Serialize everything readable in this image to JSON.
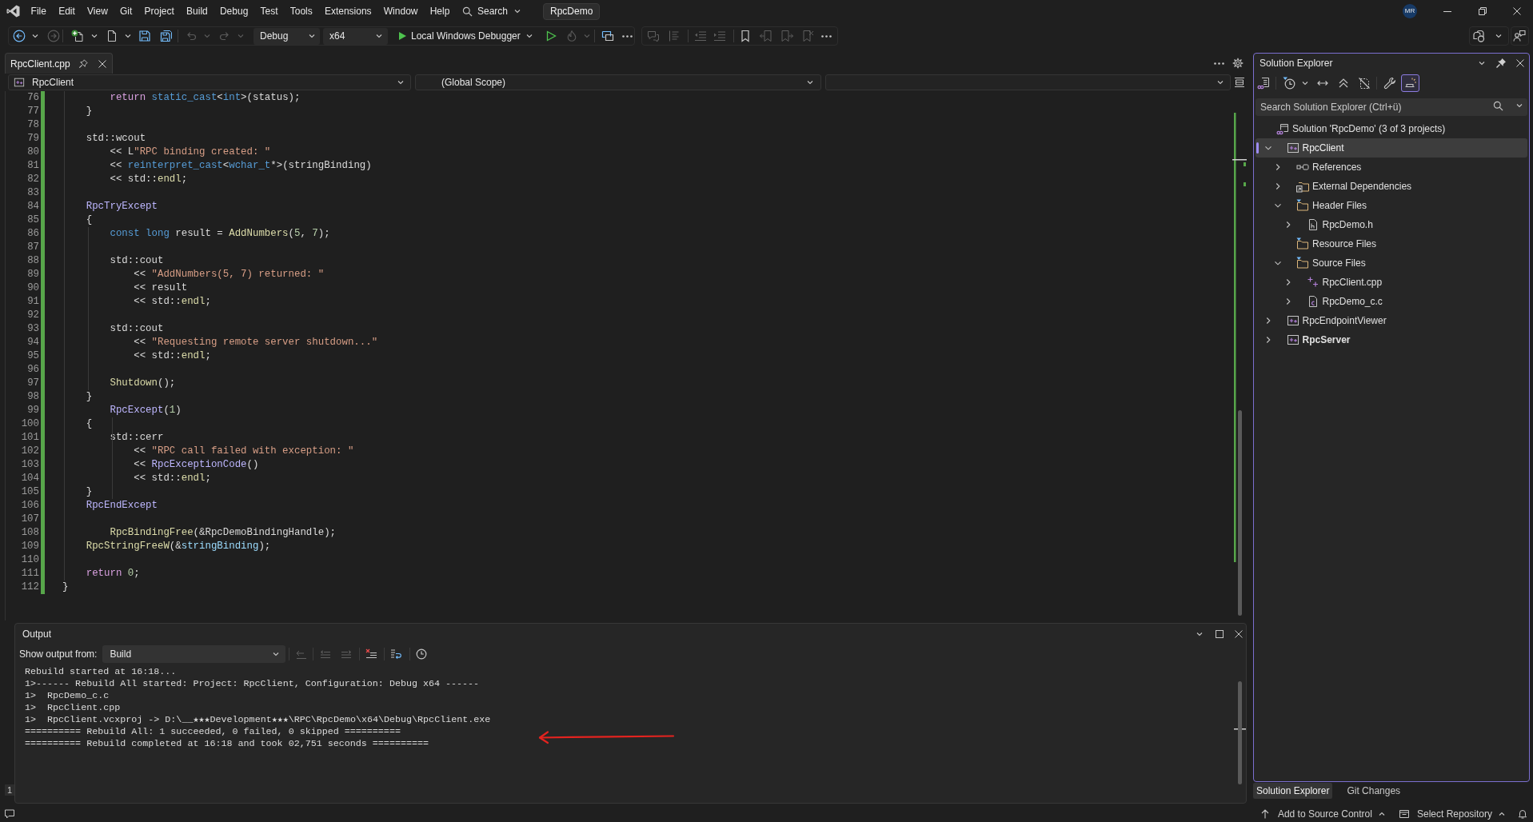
{
  "title_bar": {
    "menu": [
      "File",
      "Edit",
      "View",
      "Git",
      "Project",
      "Build",
      "Debug",
      "Test",
      "Tools",
      "Extensions",
      "Window",
      "Help"
    ],
    "search": "Search",
    "solution_name": "RpcDemo",
    "account_initials": "MR"
  },
  "toolbar": {
    "configuration": "Debug",
    "platform": "x64",
    "start_debugging": "Local Windows Debugger"
  },
  "editor": {
    "tabs": [
      {
        "label": "RpcClient.cpp",
        "selected": true
      }
    ],
    "navigation": {
      "project": "RpcClient",
      "scope": "(Global Scope)"
    },
    "lines": [
      {
        "number": "76",
        "tokens": [
          {
            "text": "        return",
            "kind": "control"
          },
          {
            "text": " static_cast",
            "kind": "keyword"
          },
          {
            "text": "<",
            "kind": "plain"
          },
          {
            "text": "int",
            "kind": "keyword"
          },
          {
            "text": ">(status);",
            "kind": "plain"
          }
        ]
      },
      {
        "number": "77",
        "tokens": [
          {
            "text": "    }",
            "kind": "plain"
          }
        ]
      },
      {
        "number": "78"
      },
      {
        "number": "79",
        "tokens": [
          {
            "text": "    std::wcout",
            "kind": "plain"
          }
        ]
      },
      {
        "number": "80",
        "tokens": [
          {
            "text": "        << L",
            "kind": "plain"
          },
          {
            "text": "\"RPC binding created: \"",
            "kind": "string"
          }
        ]
      },
      {
        "number": "81",
        "tokens": [
          {
            "text": "        << ",
            "kind": "plain"
          },
          {
            "text": "reinterpret_cast",
            "kind": "keyword"
          },
          {
            "text": "<",
            "kind": "plain"
          },
          {
            "text": "wchar_t",
            "kind": "keyword"
          },
          {
            "text": "*>(stringBinding)",
            "kind": "plain"
          }
        ]
      },
      {
        "number": "82",
        "tokens": [
          {
            "text": "        << std::",
            "kind": "plain"
          },
          {
            "text": "endl",
            "kind": "function"
          },
          {
            "text": ";",
            "kind": "plain"
          }
        ]
      },
      {
        "number": "83"
      },
      {
        "number": "84",
        "tokens": [
          {
            "text": "    RpcTryExcept",
            "kind": "macro"
          }
        ]
      },
      {
        "number": "85",
        "tokens": [
          {
            "text": "    {",
            "kind": "plain"
          }
        ]
      },
      {
        "number": "86",
        "tokens": [
          {
            "text": "        const long",
            "kind": "keyword"
          },
          {
            "text": " result = ",
            "kind": "plain"
          },
          {
            "text": "AddNumbers",
            "kind": "function"
          },
          {
            "text": "(",
            "kind": "plain"
          },
          {
            "text": "5",
            "kind": "number"
          },
          {
            "text": ", ",
            "kind": "plain"
          },
          {
            "text": "7",
            "kind": "number"
          },
          {
            "text": ");",
            "kind": "plain"
          }
        ]
      },
      {
        "number": "87"
      },
      {
        "number": "88",
        "tokens": [
          {
            "text": "        std::cout",
            "kind": "plain"
          }
        ]
      },
      {
        "number": "89",
        "tokens": [
          {
            "text": "            << ",
            "kind": "plain"
          },
          {
            "text": "\"AddNumbers(5, 7) returned: \"",
            "kind": "string"
          }
        ]
      },
      {
        "number": "90",
        "tokens": [
          {
            "text": "            << result",
            "kind": "plain"
          }
        ]
      },
      {
        "number": "91",
        "tokens": [
          {
            "text": "            << std::",
            "kind": "plain"
          },
          {
            "text": "endl",
            "kind": "function"
          },
          {
            "text": ";",
            "kind": "plain"
          }
        ]
      },
      {
        "number": "92"
      },
      {
        "number": "93",
        "tokens": [
          {
            "text": "        std::cout",
            "kind": "plain"
          }
        ]
      },
      {
        "number": "94",
        "tokens": [
          {
            "text": "            << ",
            "kind": "plain"
          },
          {
            "text": "\"Requesting remote server shutdown...\"",
            "kind": "string"
          }
        ]
      },
      {
        "number": "95",
        "tokens": [
          {
            "text": "            << std::",
            "kind": "plain"
          },
          {
            "text": "endl",
            "kind": "function"
          },
          {
            "text": ";",
            "kind": "plain"
          }
        ]
      },
      {
        "number": "96"
      },
      {
        "number": "97",
        "tokens": [
          {
            "text": "        Shutdown",
            "kind": "function"
          },
          {
            "text": "();",
            "kind": "plain"
          }
        ]
      },
      {
        "number": "98",
        "tokens": [
          {
            "text": "    }",
            "kind": "plain"
          }
        ]
      },
      {
        "number": "99",
        "tokens": [
          {
            "text": "        RpcExcept",
            "kind": "macro"
          },
          {
            "text": "(",
            "kind": "plain"
          },
          {
            "text": "1",
            "kind": "number"
          },
          {
            "text": ")",
            "kind": "plain"
          }
        ]
      },
      {
        "number": "100",
        "tokens": [
          {
            "text": "    {",
            "kind": "plain"
          }
        ]
      },
      {
        "number": "101",
        "tokens": [
          {
            "text": "        std::cerr",
            "kind": "plain"
          }
        ]
      },
      {
        "number": "102",
        "tokens": [
          {
            "text": "            << ",
            "kind": "plain"
          },
          {
            "text": "\"RPC call failed with exception: \"",
            "kind": "string"
          }
        ]
      },
      {
        "number": "103",
        "tokens": [
          {
            "text": "            << ",
            "kind": "plain"
          },
          {
            "text": "RpcExceptionCode",
            "kind": "macro"
          },
          {
            "text": "()",
            "kind": "plain"
          }
        ]
      },
      {
        "number": "104",
        "tokens": [
          {
            "text": "            << std::",
            "kind": "plain"
          },
          {
            "text": "endl",
            "kind": "function"
          },
          {
            "text": ";",
            "kind": "plain"
          }
        ]
      },
      {
        "number": "105",
        "tokens": [
          {
            "text": "    }",
            "kind": "plain"
          }
        ]
      },
      {
        "number": "106",
        "tokens": [
          {
            "text": "    RpcEndExcept",
            "kind": "macro"
          }
        ]
      },
      {
        "number": "107"
      },
      {
        "number": "108",
        "tokens": [
          {
            "text": "        RpcBindingFree",
            "kind": "function"
          },
          {
            "text": "(&RpcDemoBindingHandle);",
            "kind": "plain"
          }
        ]
      },
      {
        "number": "109",
        "tokens": [
          {
            "text": "    RpcStringFreeW",
            "kind": "function"
          },
          {
            "text": "(&",
            "kind": "plain"
          },
          {
            "text": "stringBinding",
            "kind": "variable"
          },
          {
            "text": ");",
            "kind": "plain"
          }
        ]
      },
      {
        "number": "110"
      },
      {
        "number": "111",
        "tokens": [
          {
            "text": "    return",
            "kind": "control"
          },
          {
            "text": " 0",
            "kind": "number"
          },
          {
            "text": ";",
            "kind": "plain"
          }
        ]
      },
      {
        "number": "112",
        "tokens": [
          {
            "text": "}",
            "kind": "plain"
          }
        ]
      }
    ]
  },
  "editor_status_bar": {
    "column_1": "1"
  },
  "output": {
    "title": "Output",
    "source_label": "Show output from:",
    "source": "Build",
    "lines": [
      "Rebuild started at 16:18...",
      "1>------ Rebuild All started: Project: RpcClient, Configuration: Debug x64 ------",
      "1>  RpcDemo_c.c",
      "1>  RpcClient.cpp",
      "1>  RpcClient.vcxproj -> D:\\__★★★Development★★★\\RPC\\RpcDemo\\x64\\Debug\\RpcClient.exe",
      "========== Rebuild All: 1 succeeded, 0 failed, 0 skipped ==========",
      "========== Rebuild completed at 16:18 and took 02,751 seconds =========="
    ]
  },
  "solution_explorer": {
    "title": "Solution Explorer",
    "preview_pressed": true,
    "search": {
      "placeholder": "Search Solution Explorer (Ctrl+ü)"
    },
    "tree": [
      {
        "label": "Solution 'RpcDemo' (3 of 3 projects)",
        "kind": "solution",
        "selected": false,
        "children": [
          {
            "label": "RpcClient",
            "kind": "project",
            "expanded": true,
            "selected": true,
            "startup": false,
            "children": [
              {
                "label": "References",
                "kind": "references",
                "expanded": false,
                "selected": false
              },
              {
                "label": "External Dependencies",
                "kind": "dependencies",
                "expanded": false,
                "selected": false
              },
              {
                "label": "Header Files",
                "kind": "filter",
                "expanded": true,
                "selected": false,
                "children": [
                  {
                    "label": "RpcDemo.h",
                    "kind": "header",
                    "expanded": false,
                    "selected": false
                  }
                ]
              },
              {
                "label": "Resource Files",
                "kind": "filter",
                "selected": false
              },
              {
                "label": "Source Files",
                "kind": "filter",
                "expanded": true,
                "selected": false,
                "children": [
                  {
                    "label": "RpcClient.cpp",
                    "kind": "cpp_source",
                    "expanded": false,
                    "selected": false
                  },
                  {
                    "label": "RpcDemo_c.c",
                    "kind": "c_source",
                    "expanded": false,
                    "selected": false
                  }
                ]
              }
            ]
          },
          {
            "label": "RpcEndpointViewer",
            "kind": "project",
            "expanded": false,
            "selected": false,
            "startup": false
          },
          {
            "label": "RpcServer",
            "kind": "project",
            "expanded": false,
            "selected": false,
            "startup": true
          }
        ]
      }
    ],
    "tabs": [
      {
        "label": "Solution Explorer",
        "selected": true
      },
      {
        "label": "Git Changes",
        "selected": false
      }
    ]
  },
  "status_bar": {
    "items": [
      {
        "kind": "source_control",
        "label": "Add to Source Control"
      },
      {
        "kind": "repository",
        "label": "Select Repository"
      }
    ]
  }
}
